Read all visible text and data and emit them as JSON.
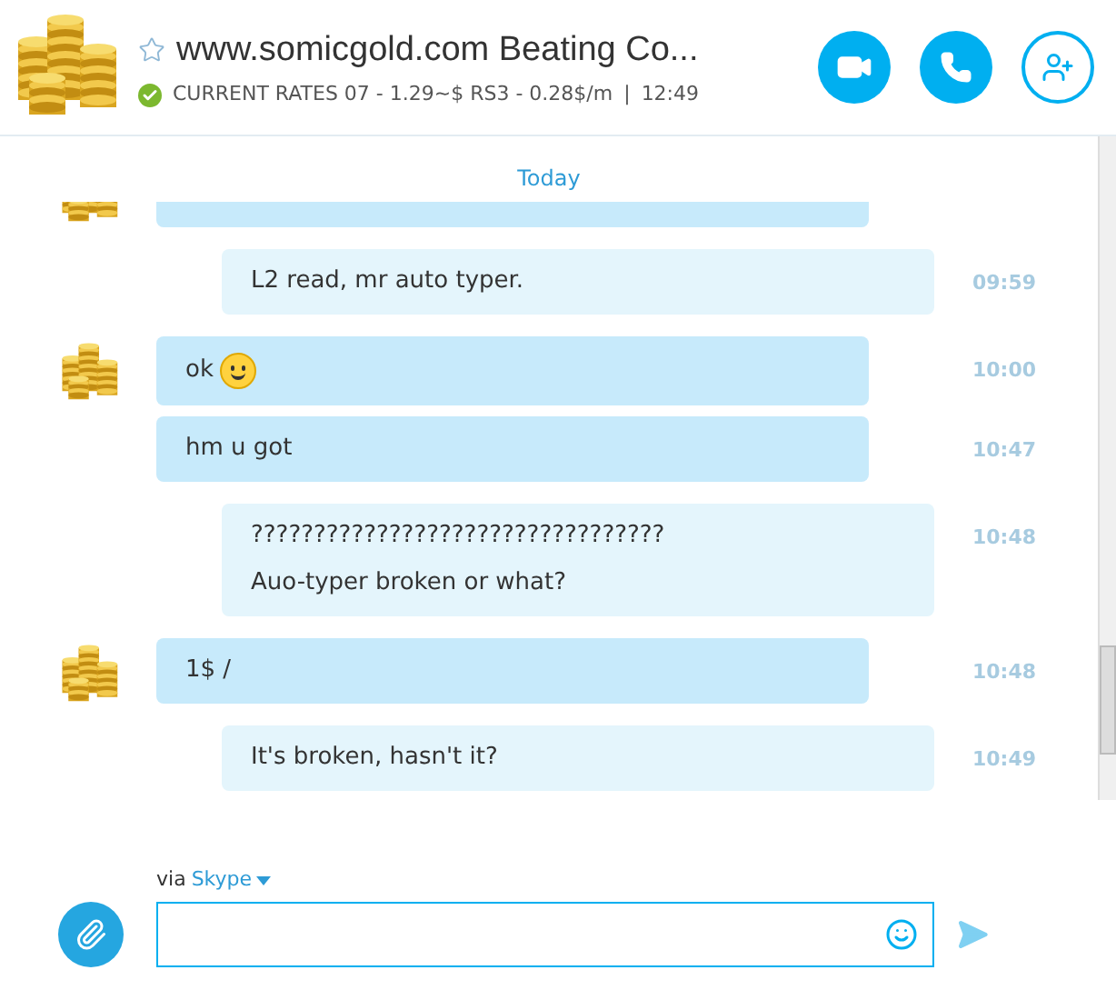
{
  "header": {
    "title": "www.somicgold.com Beating Co...",
    "favorite": false,
    "online": true,
    "status": "CURRENT RATES 07 - 1.29~$ RS3 - 0.28$/m",
    "separator": "|",
    "local_time": "12:49"
  },
  "date_divider": "Today",
  "messages": [
    {
      "kind": "me",
      "avatar": false,
      "lines": [
        "L2 read, mr auto typer."
      ],
      "emoticon": false,
      "time": "09:59"
    },
    {
      "kind": "them",
      "avatar": true,
      "lines": [
        "ok"
      ],
      "emoticon": true,
      "time": "10:00"
    },
    {
      "kind": "them",
      "avatar": false,
      "lines": [
        "hm u got"
      ],
      "emoticon": false,
      "time": "10:47"
    },
    {
      "kind": "me",
      "avatar": false,
      "lines": [
        "?????????????????????????????????",
        "Auo-typer broken or what?"
      ],
      "emoticon": false,
      "time": "10:48"
    },
    {
      "kind": "them",
      "avatar": true,
      "lines": [
        "1$ /"
      ],
      "emoticon": false,
      "time": "10:48"
    },
    {
      "kind": "me",
      "avatar": false,
      "lines": [
        "It's broken, hasn't it?"
      ],
      "emoticon": false,
      "time": "10:49"
    }
  ],
  "scrolled_off_message": {
    "kind": "them",
    "avatar": true
  },
  "composer": {
    "via": "via",
    "service": "Skype"
  }
}
